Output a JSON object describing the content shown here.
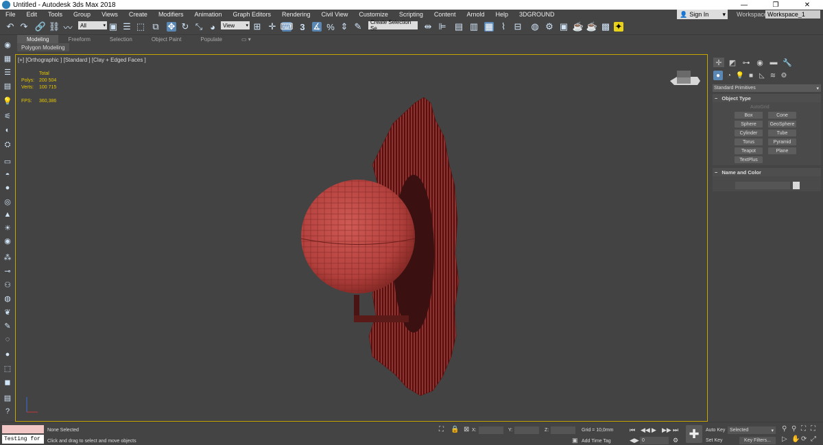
{
  "window": {
    "title": "Untitled - Autodesk 3ds Max 2018",
    "min": "—",
    "max": "❐",
    "close": "✕"
  },
  "menu": [
    "File",
    "Edit",
    "Tools",
    "Group",
    "Views",
    "Create",
    "Modifiers",
    "Animation",
    "Graph Editors",
    "Rendering",
    "Civil View",
    "Customize",
    "Scripting",
    "Content",
    "Arnold",
    "Help",
    "3DGROUND"
  ],
  "signin": {
    "label": "Sign In",
    "arrow": "▾"
  },
  "workspace": {
    "label": "Workspaces:",
    "value": "Workspace_1"
  },
  "toolbar": {
    "filter": "All",
    "view": "View",
    "selection_set": "Create Selection Se",
    "snap_value": "3",
    "arrow": "▾"
  },
  "ribbon": {
    "tabs": [
      "Modeling",
      "Freeform",
      "Selection",
      "Object Paint",
      "Populate"
    ],
    "active": "Modeling",
    "subpanel": "Polygon Modeling"
  },
  "viewport": {
    "label": "[+] [Orthographic ] [Standard ] [Clay + Edged Faces ]",
    "stats": {
      "header": "Total",
      "polys_label": "Polys:",
      "polys": "200 504",
      "verts_label": "Verts:",
      "verts": "100 715",
      "fps_label": "FPS:",
      "fps": "360,386"
    }
  },
  "command_panel": {
    "category": "Standard Primitives",
    "object_type": {
      "title": "Object Type",
      "autogrid": "AutoGrid",
      "buttons": [
        "Box",
        "Cone",
        "Sphere",
        "GeoSphere",
        "Cylinder",
        "Tube",
        "Torus",
        "Pyramid",
        "Teapot",
        "Plane",
        "TextPlus"
      ]
    },
    "name_color": {
      "title": "Name and Color"
    },
    "collapse": "−"
  },
  "status": {
    "maxscript_text": "Testing for :",
    "selection": "None Selected",
    "prompt": "Click and drag to select and move objects",
    "x_label": "X:",
    "y_label": "Y:",
    "z_label": "Z:",
    "grid": "Grid = 10,0mm",
    "add_time_tag": "Add Time Tag",
    "frame": "0",
    "auto_key": "Auto Key",
    "set_key": "Set Key",
    "selected": "Selected",
    "key_filters": "Key Filters..."
  },
  "colors": {
    "viewport_border": "#c8a800",
    "model": "#b84a46",
    "active_blue": "#5b87b5"
  }
}
